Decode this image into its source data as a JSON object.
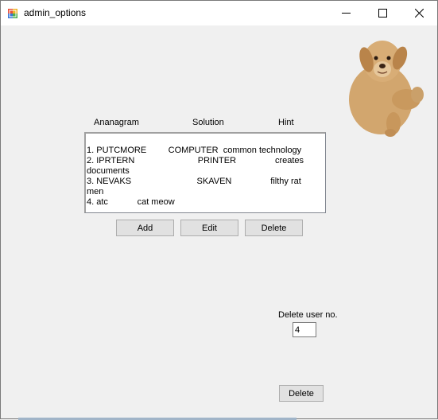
{
  "window": {
    "title": "admin_options",
    "controls": {
      "minimize": "minimize",
      "maximize": "maximize",
      "close": "close"
    }
  },
  "columns": {
    "anagram": "Ananagram",
    "solution": "Solution",
    "hint": "Hint"
  },
  "listbox": {
    "lines": [
      "1. PUTCMORE         COMPUTER  common technology",
      "2. IPRTERN                          PRINTER                creates",
      "documents",
      "3. NEVAKS                           SKAVEN                filthy rat",
      "men",
      "4. atc            cat meow"
    ]
  },
  "buttons": {
    "add": "Add",
    "edit": "Edit",
    "delete": "Delete",
    "delete_user": "Delete"
  },
  "delete_user": {
    "label": "Delete user no.",
    "value": "4"
  },
  "icons": {
    "app": "form-app-icon",
    "dog": "dog-image"
  }
}
